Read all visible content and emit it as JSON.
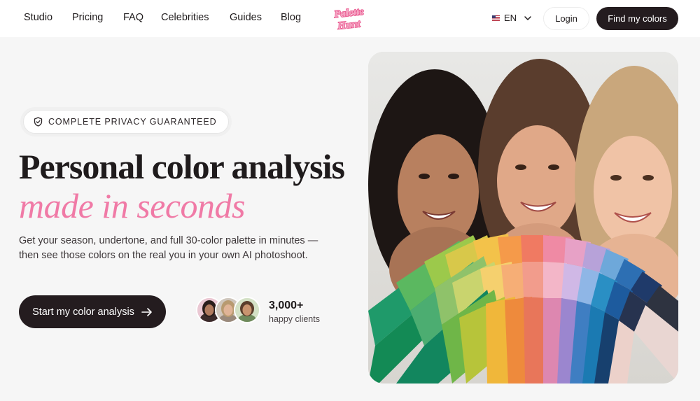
{
  "nav": {
    "links": [
      "Studio",
      "Pricing",
      "FAQ",
      "Celebrities",
      "Guides",
      "Blog"
    ],
    "logo_text_1": "Palette",
    "logo_text_2": "Hunt",
    "language": "EN",
    "login_label": "Login",
    "cta_label": "Find my colors"
  },
  "hero": {
    "badge": "COMPLETE PRIVACY GUARANTEED",
    "headline": "Personal color analysis",
    "headline_accent": "made in seconds",
    "subtitle": "Get your season, undertone, and full 30-color palette in minutes — then see those colors on the real you in your own AI photoshoot.",
    "start_label": "Start my color analysis",
    "clients_count": "3,000+",
    "clients_label": "happy clients"
  },
  "colors": {
    "brand_pink": "#f07aa6",
    "dark": "#241c1f"
  },
  "icons": {
    "badge": "shield-check-icon",
    "arrow": "arrow-right-icon",
    "language_caret": "chevron-down-icon",
    "flag": "us-flag-icon"
  }
}
